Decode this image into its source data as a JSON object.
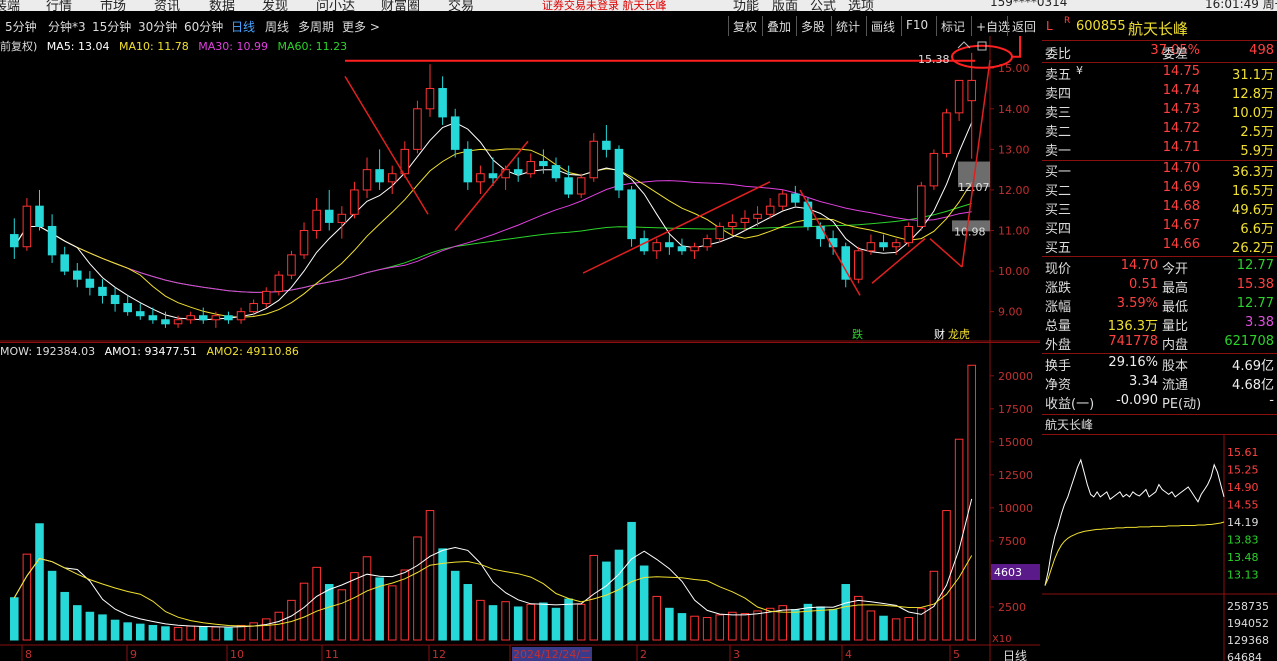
{
  "top_menu": {
    "items": [
      "装端",
      "行情",
      "市场",
      "资讯",
      "数据",
      "发现",
      "问小达",
      "财富圈",
      "交易"
    ],
    "alert": "证券交易未登录  航天长峰",
    "right_items": [
      "功能",
      "版面",
      "公式",
      "选项"
    ],
    "account": "159****0314",
    "time": "16:01:49 周一"
  },
  "period_bar": {
    "periods": [
      "5分钟",
      "分钟*3",
      "15分钟",
      "30分钟",
      "60分钟",
      "日线",
      "周线",
      "多周期",
      "更多 >"
    ],
    "active_index": 5,
    "tools": [
      "复权",
      "叠加",
      "多股",
      "统计",
      "画线",
      "F10",
      "标记",
      "+自选",
      "返回"
    ]
  },
  "ma_legend": {
    "prefix": "前复权)",
    "items": [
      {
        "text": "MA5: 13.04",
        "color": "#ffffff"
      },
      {
        "text": "MA10: 11.78",
        "color": "#f0e030"
      },
      {
        "text": "MA30: 10.99",
        "color": "#e040e0"
      },
      {
        "text": "MA60: 11.23",
        "color": "#2bd42b"
      }
    ]
  },
  "vol_legend": {
    "items": [
      {
        "text": "MOW: 192384.03",
        "color": "#dddddd"
      },
      {
        "text": "AMO1: 93477.51",
        "color": "#ffffff"
      },
      {
        "text": "AMO2: 49110.86",
        "color": "#f0e030"
      }
    ]
  },
  "chart_data": [
    {
      "type": "candlestick",
      "title": "日线",
      "y_ticks": [
        "15.00",
        "14.00",
        "13.00",
        "12.00",
        "11.00",
        "10.00",
        "9.00"
      ],
      "ylim": [
        8.4,
        15.4
      ],
      "price_markers": {
        "high": "15.38",
        "level_a": "12.07",
        "level_b": "10.98"
      },
      "x_labels": [
        "8",
        "9",
        "10",
        "11",
        "12",
        "2024/12/24/二",
        "2",
        "3",
        "4",
        "5"
      ],
      "badges": [
        "跌",
        "财",
        "龙虎"
      ],
      "ohlc": [
        [
          10.9,
          11.3,
          10.3,
          10.6
        ],
        [
          10.6,
          11.8,
          10.5,
          11.6
        ],
        [
          11.6,
          12.0,
          11.0,
          11.1
        ],
        [
          11.1,
          11.4,
          10.2,
          10.4
        ],
        [
          10.4,
          10.6,
          9.9,
          10.0
        ],
        [
          10.0,
          10.2,
          9.6,
          9.8
        ],
        [
          9.8,
          10.0,
          9.4,
          9.6
        ],
        [
          9.6,
          9.8,
          9.2,
          9.4
        ],
        [
          9.4,
          9.6,
          9.0,
          9.2
        ],
        [
          9.2,
          9.4,
          8.9,
          9.0
        ],
        [
          9.0,
          9.2,
          8.8,
          8.9
        ],
        [
          8.9,
          9.1,
          8.7,
          8.8
        ],
        [
          8.8,
          9.0,
          8.6,
          8.7
        ],
        [
          8.7,
          8.9,
          8.6,
          8.8
        ],
        [
          8.8,
          9.0,
          8.7,
          8.9
        ],
        [
          8.9,
          9.1,
          8.7,
          8.8
        ],
        [
          8.8,
          9.0,
          8.6,
          8.9
        ],
        [
          8.9,
          9.0,
          8.7,
          8.8
        ],
        [
          8.8,
          9.1,
          8.7,
          9.0
        ],
        [
          9.0,
          9.3,
          8.9,
          9.2
        ],
        [
          9.2,
          9.6,
          9.1,
          9.5
        ],
        [
          9.5,
          10.0,
          9.4,
          9.9
        ],
        [
          9.9,
          10.5,
          9.8,
          10.4
        ],
        [
          10.4,
          11.2,
          10.3,
          11.0
        ],
        [
          11.0,
          11.8,
          10.8,
          11.5
        ],
        [
          11.5,
          12.0,
          11.0,
          11.2
        ],
        [
          11.2,
          11.6,
          10.8,
          11.4
        ],
        [
          11.4,
          12.2,
          11.3,
          12.0
        ],
        [
          12.0,
          12.8,
          11.8,
          12.5
        ],
        [
          12.5,
          13.0,
          12.0,
          12.2
        ],
        [
          12.2,
          12.6,
          11.9,
          12.4
        ],
        [
          12.4,
          13.2,
          12.3,
          13.0
        ],
        [
          13.0,
          14.2,
          12.9,
          14.0
        ],
        [
          14.0,
          15.1,
          13.8,
          14.5
        ],
        [
          14.5,
          14.8,
          13.6,
          13.8
        ],
        [
          13.8,
          14.0,
          12.8,
          13.0
        ],
        [
          13.0,
          13.2,
          12.0,
          12.2
        ],
        [
          12.2,
          12.6,
          11.9,
          12.4
        ],
        [
          12.4,
          12.8,
          12.1,
          12.3
        ],
        [
          12.3,
          12.6,
          12.0,
          12.5
        ],
        [
          12.5,
          12.8,
          12.2,
          12.4
        ],
        [
          12.4,
          12.9,
          12.3,
          12.7
        ],
        [
          12.7,
          13.0,
          12.4,
          12.6
        ],
        [
          12.6,
          12.8,
          12.2,
          12.3
        ],
        [
          12.3,
          12.6,
          11.8,
          11.9
        ],
        [
          11.9,
          12.4,
          11.8,
          12.3
        ],
        [
          12.3,
          13.4,
          12.2,
          13.2
        ],
        [
          13.2,
          13.6,
          12.8,
          13.0
        ],
        [
          13.0,
          13.1,
          11.8,
          12.0
        ],
        [
          12.0,
          12.1,
          10.6,
          10.8
        ],
        [
          10.8,
          11.0,
          10.4,
          10.5
        ],
        [
          10.5,
          10.8,
          10.3,
          10.7
        ],
        [
          10.7,
          10.9,
          10.4,
          10.6
        ],
        [
          10.6,
          10.8,
          10.4,
          10.5
        ],
        [
          10.5,
          10.7,
          10.3,
          10.6
        ],
        [
          10.6,
          10.9,
          10.5,
          10.8
        ],
        [
          10.8,
          11.2,
          10.7,
          11.1
        ],
        [
          11.1,
          11.4,
          10.9,
          11.2
        ],
        [
          11.2,
          11.5,
          11.0,
          11.3
        ],
        [
          11.3,
          11.6,
          11.1,
          11.4
        ],
        [
          11.4,
          11.8,
          11.3,
          11.6
        ],
        [
          11.6,
          12.0,
          11.5,
          11.9
        ],
        [
          11.9,
          12.1,
          11.6,
          11.7
        ],
        [
          11.7,
          11.8,
          11.0,
          11.1
        ],
        [
          11.1,
          11.2,
          10.6,
          10.8
        ],
        [
          10.8,
          11.0,
          10.4,
          10.6
        ],
        [
          10.6,
          10.7,
          9.6,
          9.8
        ],
        [
          9.8,
          10.6,
          9.7,
          10.5
        ],
        [
          10.5,
          10.9,
          10.4,
          10.7
        ],
        [
          10.7,
          10.9,
          10.5,
          10.6
        ],
        [
          10.6,
          10.8,
          10.4,
          10.7
        ],
        [
          10.7,
          11.2,
          10.6,
          11.1
        ],
        [
          11.1,
          12.2,
          11.0,
          12.1
        ],
        [
          12.1,
          13.0,
          12.0,
          12.9
        ],
        [
          12.9,
          14.0,
          12.8,
          13.9
        ],
        [
          13.9,
          14.7,
          13.7,
          14.7
        ],
        [
          14.2,
          15.38,
          12.77,
          14.7
        ]
      ],
      "ma_colors": {
        "ma5": "#ffffff",
        "ma10": "#f0e030",
        "ma30": "#e040e0",
        "ma60": "#2bd42b"
      }
    },
    {
      "type": "bar",
      "title": "MOW",
      "y_ticks": [
        "20000",
        "17500",
        "15000",
        "12500",
        "10000",
        "7500",
        "5000",
        "2500"
      ],
      "ylim": [
        0,
        21500
      ],
      "unit": "X10",
      "current_label": "4603",
      "volumes": [
        3200,
        6500,
        8800,
        5200,
        3600,
        2600,
        2100,
        1900,
        1500,
        1300,
        1200,
        1100,
        1000,
        950,
        1050,
        1000,
        980,
        900,
        1100,
        1300,
        1600,
        2100,
        3000,
        4300,
        5500,
        4200,
        3800,
        5100,
        6300,
        4700,
        4100,
        5300,
        7800,
        9800,
        6900,
        5200,
        4200,
        3000,
        2600,
        2900,
        2500,
        2700,
        2800,
        2400,
        3100,
        2700,
        6400,
        5900,
        6800,
        8900,
        5600,
        3300,
        2400,
        2000,
        1800,
        1700,
        1900,
        2100,
        2000,
        2200,
        2400,
        2600,
        2300,
        2700,
        2500,
        2300,
        4200,
        3300,
        2200,
        1800,
        1600,
        1700,
        2400,
        5200,
        9800,
        15200,
        20800
      ]
    },
    {
      "type": "line",
      "title": "航天长峰",
      "y_ticks": [
        "15.61",
        "15.25",
        "14.90",
        "14.55",
        "14.19",
        "13.83",
        "13.48",
        "13.13"
      ],
      "ylim": [
        12.77,
        15.61
      ],
      "volume_ticks": [
        "258735",
        "194052",
        "129368",
        "64684"
      ],
      "price": [
        12.9,
        13.2,
        13.6,
        13.9,
        14.1,
        14.35,
        14.55,
        14.7,
        14.9,
        15.1,
        15.3,
        15.45,
        15.2,
        14.95,
        14.75,
        14.7,
        14.8,
        14.7,
        14.75,
        14.8,
        14.65,
        14.7,
        14.75,
        14.8,
        14.7,
        14.75,
        14.7,
        14.8,
        14.75,
        14.72,
        14.78,
        14.85,
        14.7,
        14.75,
        14.8,
        14.95,
        14.85,
        14.8,
        14.75,
        14.8,
        14.7,
        14.75,
        14.8,
        14.85,
        14.9,
        14.8,
        14.7,
        14.6,
        14.75,
        14.85,
        14.95,
        15.1,
        15.35,
        15.2,
        14.95,
        14.7
      ],
      "avg_price": [
        12.9,
        13.05,
        13.25,
        13.45,
        13.6,
        13.72,
        13.8,
        13.86,
        13.9,
        13.93,
        13.96,
        13.98,
        14.0,
        14.01,
        14.02,
        14.03,
        14.04,
        14.04,
        14.05,
        14.05,
        14.06,
        14.06,
        14.07,
        14.07,
        14.07,
        14.08,
        14.08,
        14.08,
        14.08,
        14.09,
        14.09,
        14.09,
        14.09,
        14.1,
        14.1,
        14.1,
        14.1,
        14.1,
        14.11,
        14.11,
        14.11,
        14.11,
        14.12,
        14.12,
        14.12,
        14.12,
        14.12,
        14.13,
        14.13,
        14.13,
        14.14,
        14.14,
        14.15,
        14.16,
        14.17,
        14.19
      ]
    }
  ],
  "quote": {
    "market_letter": "L",
    "r_mark": "R",
    "code": "600855",
    "name": "航天长峰",
    "weibi_label": "委比",
    "weibi": "37.05%",
    "weicha_label": "委差",
    "weicha": "498",
    "asks": [
      {
        "label": "卖五",
        "extra": "¥",
        "price": "14.75",
        "vol": "31.1万"
      },
      {
        "label": "卖四",
        "extra": "",
        "price": "14.74",
        "vol": "12.8万"
      },
      {
        "label": "卖三",
        "extra": "",
        "price": "14.73",
        "vol": "10.0万"
      },
      {
        "label": "卖二",
        "extra": "",
        "price": "14.72",
        "vol": "2.5万"
      },
      {
        "label": "卖一",
        "extra": "",
        "price": "14.71",
        "vol": "5.9万"
      }
    ],
    "bids": [
      {
        "label": "买一",
        "price": "14.70",
        "vol": "36.3万"
      },
      {
        "label": "买二",
        "price": "14.69",
        "vol": "16.5万"
      },
      {
        "label": "买三",
        "price": "14.68",
        "vol": "49.6万"
      },
      {
        "label": "买四",
        "price": "14.67",
        "vol": "6.6万"
      },
      {
        "label": "买五",
        "price": "14.66",
        "vol": "26.2万"
      }
    ],
    "stats1": [
      {
        "l": "现价",
        "v": "14.70",
        "vc": "red",
        "l2": "今开",
        "v2": "12.77",
        "v2c": "green"
      },
      {
        "l": "涨跌",
        "v": "0.51",
        "vc": "red",
        "l2": "最高",
        "v2": "15.38",
        "v2c": "red"
      },
      {
        "l": "涨幅",
        "v": "3.59%",
        "vc": "red",
        "l2": "最低",
        "v2": "12.77",
        "v2c": "green"
      },
      {
        "l": "总量",
        "v": "136.3万",
        "vc": "yellow",
        "l2": "量比",
        "v2": "3.38",
        "v2c": "magenta"
      },
      {
        "l": "外盘",
        "v": "741778",
        "vc": "red",
        "l2": "内盘",
        "v2": "621708",
        "v2c": "green"
      }
    ],
    "stats2": [
      {
        "l": "换手",
        "v": "29.16%",
        "vc": "white",
        "l2": "股本",
        "v2": "4.69亿",
        "v2c": "white"
      },
      {
        "l": "净资",
        "v": "3.34",
        "vc": "white",
        "l2": "流通",
        "v2": "4.68亿",
        "v2c": "white"
      },
      {
        "l": "收益(一)",
        "v": "-0.090",
        "vc": "white",
        "l2": "PE(动)",
        "v2": "-",
        "v2c": "white"
      }
    ],
    "mini_title": "航天长峰"
  },
  "status_bar": {
    "period": "日线"
  }
}
